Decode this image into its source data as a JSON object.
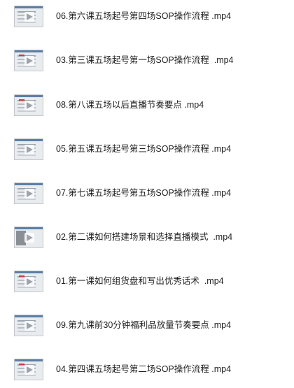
{
  "files": [
    {
      "name": "06.第六课五场起号第四场SOP操作流程 .mp4",
      "thumb": "doc"
    },
    {
      "name": "03.第三课五场起号第一场SOP操作流程  .mp4",
      "thumb": "doc-red"
    },
    {
      "name": "08.第八课五场以后直播节奏要点 .mp4",
      "thumb": "doc-red"
    },
    {
      "name": "05.第五课五场起号第三场SOP操作流程 .mp4",
      "thumb": "doc"
    },
    {
      "name": "07.第七课五场起号第五场SOP操作流程 .mp4",
      "thumb": "doc"
    },
    {
      "name": "02.第二课如何搭建场景和选择直播模式  .mp4",
      "thumb": "photo"
    },
    {
      "name": "01.第一课如何组货盘和写出优秀话术  .mp4",
      "thumb": "doc-red"
    },
    {
      "name": "09.第九课前30分钟福利品放量节奏要点 .mp4",
      "thumb": "doc"
    },
    {
      "name": "04.第四课五场起号第二场SOP操作流程 .mp4",
      "thumb": "doc-red"
    }
  ],
  "icons": {
    "thumbnail": "video-thumbnail-icon",
    "play": "play-icon"
  }
}
